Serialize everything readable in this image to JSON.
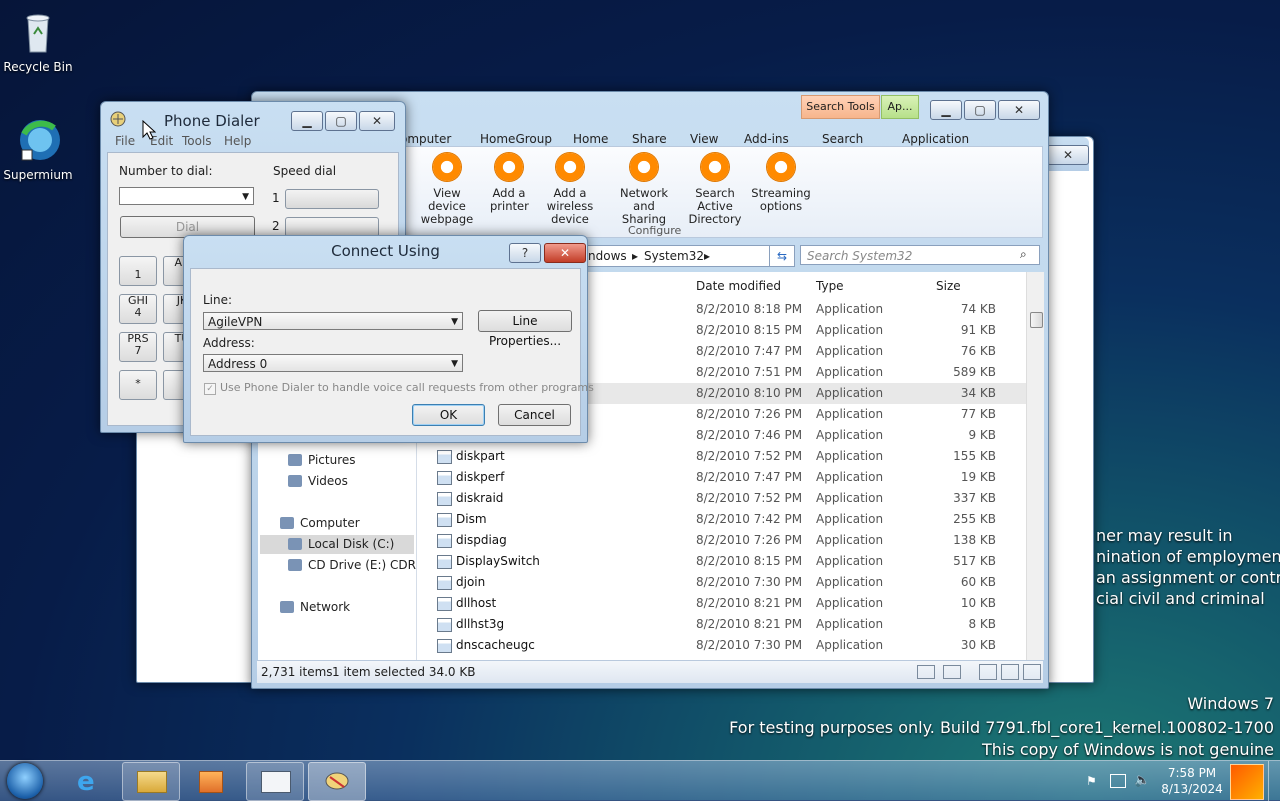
{
  "desktop": {
    "icons": [
      {
        "label": "Recycle Bin",
        "icon": "recycle-bin-icon"
      },
      {
        "label": "Supermium",
        "icon": "supermium-icon"
      }
    ],
    "watermark": {
      "line1": "Windows 7",
      "line2": "For testing purposes only. Build 7791.fbl_core1_kernel.100802-1700",
      "line3": "This copy of Windows is not genuine"
    },
    "legal_text": [
      "ner may result in",
      "nination of employment",
      "an assignment or contract",
      "cial civil and criminal"
    ]
  },
  "explorer": {
    "context_tabs": {
      "search_tools": "Search Tools",
      "app_tools": "Ap..."
    },
    "tabs": [
      "omputer",
      "HomeGroup",
      "Home",
      "Share",
      "View",
      "Add-ins",
      "Search",
      "Application"
    ],
    "ribbon_buttons": [
      {
        "label1": "View device",
        "label2": "webpage"
      },
      {
        "label1": "Add a",
        "label2": "printer"
      },
      {
        "label1": "Add a wireless",
        "label2": "device"
      },
      {
        "label1": "Network",
        "label2": "and Sharing"
      },
      {
        "label1": "Search Active",
        "label2": "Directory"
      },
      {
        "label1": "Streaming",
        "label2": "options"
      }
    ],
    "ribbon_group": "Configure",
    "breadcrumb": [
      "ndows",
      "System32"
    ],
    "search_placeholder": "Search System32",
    "columns": {
      "date": "Date modified",
      "type": "Type",
      "size": "Size"
    },
    "files": [
      {
        "name": "",
        "date": "8/2/2010 8:18 PM",
        "type": "Application",
        "size": "74 KB"
      },
      {
        "name": "",
        "date": "8/2/2010 8:15 PM",
        "type": "Application",
        "size": "91 KB"
      },
      {
        "name": "",
        "date": "8/2/2010 7:47 PM",
        "type": "Application",
        "size": "76 KB"
      },
      {
        "name": "",
        "date": "8/2/2010 7:51 PM",
        "type": "Application",
        "size": "589 KB"
      },
      {
        "name": "",
        "date": "8/2/2010 8:10 PM",
        "type": "Application",
        "size": "34 KB"
      },
      {
        "name": "",
        "date": "8/2/2010 7:26 PM",
        "type": "Application",
        "size": "77 KB"
      },
      {
        "name": "",
        "date": "8/2/2010 7:46 PM",
        "type": "Application",
        "size": "9 KB"
      },
      {
        "name": "diskpart",
        "date": "8/2/2010 7:52 PM",
        "type": "Application",
        "size": "155 KB"
      },
      {
        "name": "diskperf",
        "date": "8/2/2010 7:47 PM",
        "type": "Application",
        "size": "19 KB"
      },
      {
        "name": "diskraid",
        "date": "8/2/2010 7:52 PM",
        "type": "Application",
        "size": "337 KB"
      },
      {
        "name": "Dism",
        "date": "8/2/2010 7:42 PM",
        "type": "Application",
        "size": "255 KB"
      },
      {
        "name": "dispdiag",
        "date": "8/2/2010 7:26 PM",
        "type": "Application",
        "size": "138 KB"
      },
      {
        "name": "DisplaySwitch",
        "date": "8/2/2010 8:15 PM",
        "type": "Application",
        "size": "517 KB"
      },
      {
        "name": "djoin",
        "date": "8/2/2010 7:30 PM",
        "type": "Application",
        "size": "60 KB"
      },
      {
        "name": "dllhost",
        "date": "8/2/2010 8:21 PM",
        "type": "Application",
        "size": "10 KB"
      },
      {
        "name": "dllhst3g",
        "date": "8/2/2010 8:21 PM",
        "type": "Application",
        "size": "8 KB"
      },
      {
        "name": "dnscacheugc",
        "date": "8/2/2010 7:30 PM",
        "type": "Application",
        "size": "30 KB"
      }
    ],
    "nav": [
      {
        "label": "Pictures"
      },
      {
        "label": "Videos"
      },
      {
        "label": "Computer"
      },
      {
        "label": "Local Disk (C:)"
      },
      {
        "label": "CD Drive (E:) CDROM"
      },
      {
        "label": "Network"
      }
    ],
    "status": {
      "count": "2,731 items",
      "selected": "1 item selected  34.0 KB"
    }
  },
  "phone_dialer": {
    "title": "Phone Dialer",
    "menu": [
      "File",
      "Edit",
      "Tools",
      "Help"
    ],
    "number_label": "Number to dial:",
    "speed_label": "Speed dial",
    "dial_button": "Dial",
    "speed_numbers": [
      "1",
      "2"
    ],
    "keys": [
      {
        "top": "",
        "bottom": "1"
      },
      {
        "top": "AB",
        "bottom": ""
      },
      {
        "top": "GHI",
        "bottom": "4"
      },
      {
        "top": "JK",
        "bottom": ""
      },
      {
        "top": "PRS",
        "bottom": "7"
      },
      {
        "top": "TU",
        "bottom": ""
      },
      {
        "top": "",
        "bottom": "*"
      },
      {
        "top": "",
        "bottom": ""
      }
    ]
  },
  "dialog": {
    "title": "Connect Using",
    "help_label": "?",
    "line_label": "Line:",
    "line_value": "AgileVPN",
    "line_properties": "Line Properties...",
    "address_label": "Address:",
    "address_value": "Address 0",
    "checkbox_label": "Use Phone Dialer to handle voice call requests from other programs",
    "ok": "OK",
    "cancel": "Cancel"
  },
  "taskbar": {
    "time": "7:58 PM",
    "date": "8/13/2024",
    "buttons": [
      "start-orb",
      "internet-explorer",
      "windows-explorer",
      "media-player",
      "control-panel",
      "phone-dialer"
    ]
  }
}
